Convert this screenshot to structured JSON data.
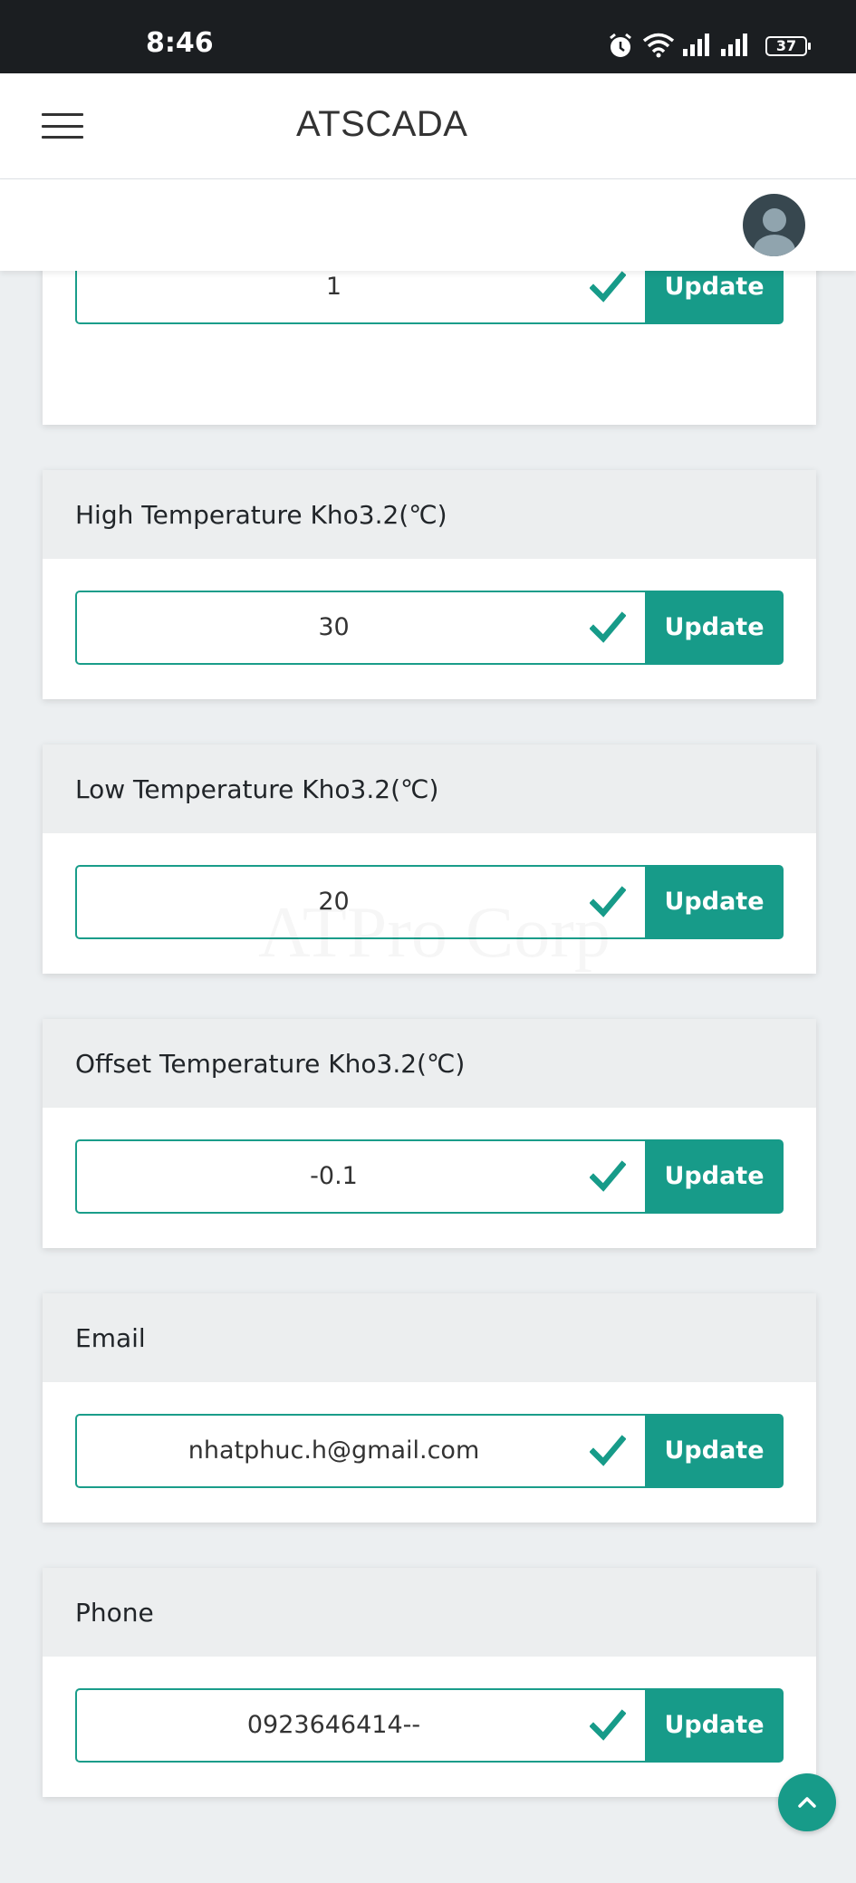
{
  "status_bar": {
    "time": "8:46",
    "battery": "37",
    "icons": [
      "alarm-icon",
      "wifi-icon",
      "signal-icon",
      "signal-icon"
    ]
  },
  "header": {
    "title": "ATSCADA",
    "menu_icon": "hamburger-icon"
  },
  "colors": {
    "accent": "#179b89",
    "card_header_bg": "#eceeef",
    "page_bg": "#eceff1"
  },
  "watermark": "ATPro Corp",
  "settings": [
    {
      "label": "",
      "value": "1",
      "button": "Update"
    },
    {
      "label": "High Temperature Kho3.2(℃)",
      "value": "30",
      "button": "Update"
    },
    {
      "label": "Low Temperature Kho3.2(℃)",
      "value": "20",
      "button": "Update"
    },
    {
      "label": "Offset Temperature Kho3.2(℃)",
      "value": "-0.1",
      "button": "Update"
    },
    {
      "label": "Email",
      "value": "nhatphuc.h@gmail.com",
      "button": "Update"
    },
    {
      "label": "Phone",
      "value": "0923646414--",
      "button": "Update"
    }
  ]
}
